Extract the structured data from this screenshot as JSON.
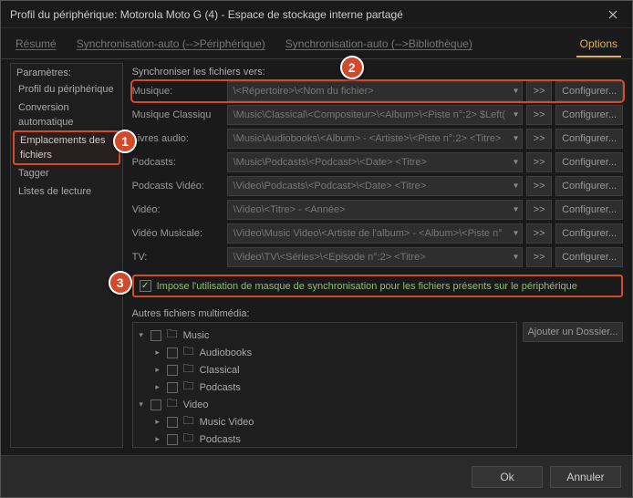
{
  "window": {
    "title": "Profil du périphérique: Motorola Moto G (4) - Espace de stockage interne partagé"
  },
  "tabs": {
    "resume": "Résumé",
    "sync_to_device": "Synchronisation-auto (-->Périphérique)",
    "sync_to_library": "Synchronisation-auto (-->Bibliothèque)",
    "options": "Options"
  },
  "sidebar": {
    "label": "Paramètres:",
    "items": [
      "Profil du périphérique",
      "Conversion automatique",
      "Emplacements des fichiers",
      "Tagger",
      "Listes de lecture"
    ]
  },
  "sync": {
    "label": "Synchroniser les fichiers vers:",
    "rows": [
      {
        "label": "Musique:",
        "value": "\\<Répertoire>\\<Nom du fichier>"
      },
      {
        "label": "Musique Classiqu",
        "value": "\\Music\\Classical\\<Compositeur>\\<Album>\\<Piste n°:2> $Left("
      },
      {
        "label": "Livres audio:",
        "value": "\\Music\\Audiobooks\\<Album> - <Artiste>\\<Piste n°:2> <Titre>"
      },
      {
        "label": "Podcasts:",
        "value": "\\Music\\Podcasts\\<Podcast>\\<Date> <Titre>"
      },
      {
        "label": "Podcasts Vidéo:",
        "value": "\\Video\\Podcasts\\<Podcast>\\<Date> <Titre>"
      },
      {
        "label": "Vidéo:",
        "value": "\\Video\\<Titre> - <Année>"
      },
      {
        "label": "Vidéo Musicale:",
        "value": "\\Video\\Music Video\\<Artiste de l'album> - <Album>\\<Piste n°"
      },
      {
        "label": "TV:",
        "value": "\\Video\\TV\\<Séries>\\<Episode n°:2> <Titre>"
      }
    ],
    "go": ">>",
    "configure": "Configurer..."
  },
  "impose": {
    "label": "Impose l'utilisation de masque de synchronisation pour les fichiers présents sur le périphérique"
  },
  "other": {
    "label": "Autres fichiers multimédia:",
    "add_folder": "Ajouter un Dossier...",
    "tree": [
      {
        "depth": 1,
        "expand": "▾",
        "name": "Music"
      },
      {
        "depth": 2,
        "expand": "▸",
        "name": "Audiobooks"
      },
      {
        "depth": 2,
        "expand": "▸",
        "name": "Classical"
      },
      {
        "depth": 2,
        "expand": "▸",
        "name": "Podcasts"
      },
      {
        "depth": 1,
        "expand": "▾",
        "name": "Video"
      },
      {
        "depth": 2,
        "expand": "▸",
        "name": "Music Video"
      },
      {
        "depth": 2,
        "expand": "▸",
        "name": "Podcasts"
      }
    ]
  },
  "footer": {
    "ok": "Ok",
    "cancel": "Annuler"
  },
  "badges": {
    "b1": "1",
    "b2": "2",
    "b3": "3"
  }
}
